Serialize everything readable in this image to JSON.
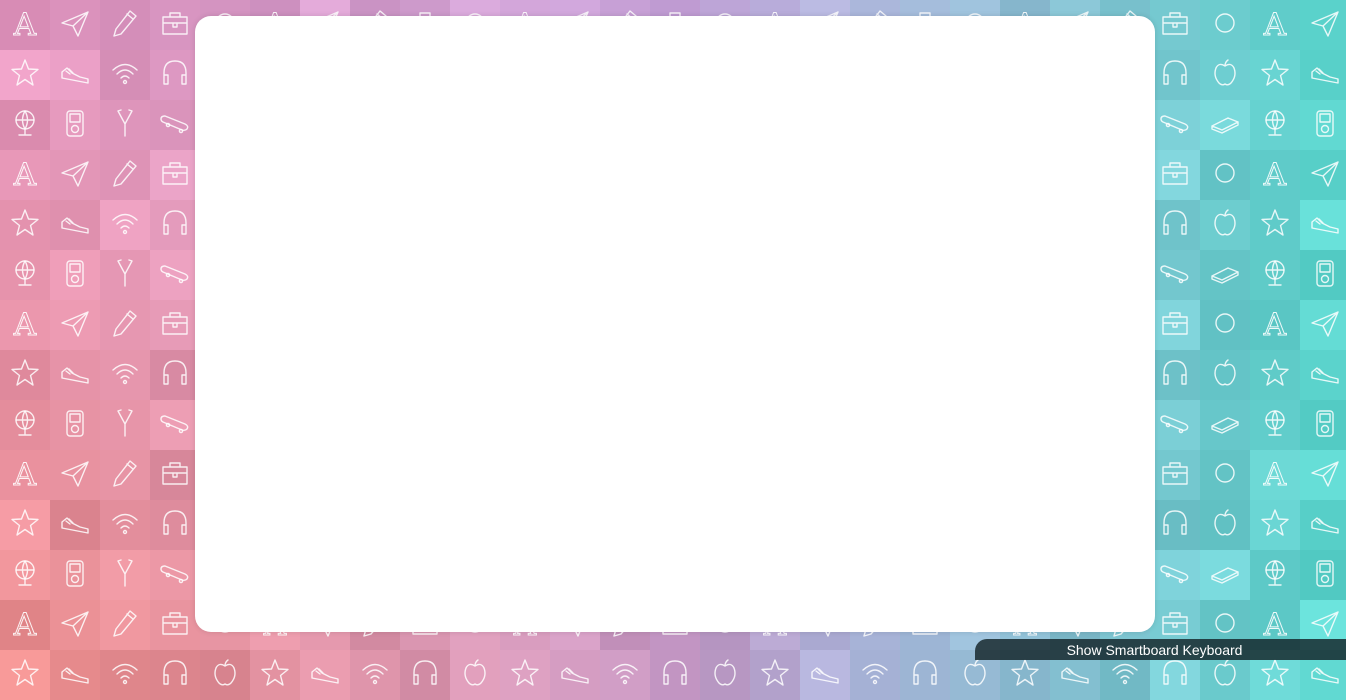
{
  "app": {
    "background_palette": {
      "left": "#e69ac3",
      "middle": "#c5a1d8",
      "right": "#5ed6cf"
    },
    "tile_icons": [
      "letter-a-icon",
      "paper-plane-icon",
      "pencil-icon",
      "bag-icon",
      "star-icon",
      "sneaker-icon",
      "wifi-icon",
      "headphones-icon",
      "globe-icon",
      "music-player-icon",
      "slingshot-icon",
      "skateboard-icon",
      "book-icon",
      "apple-icon",
      "circle-icon"
    ],
    "letter_glyph": "A"
  },
  "keyboard_toggle": {
    "label": "Show Smartboard Keyboard"
  }
}
